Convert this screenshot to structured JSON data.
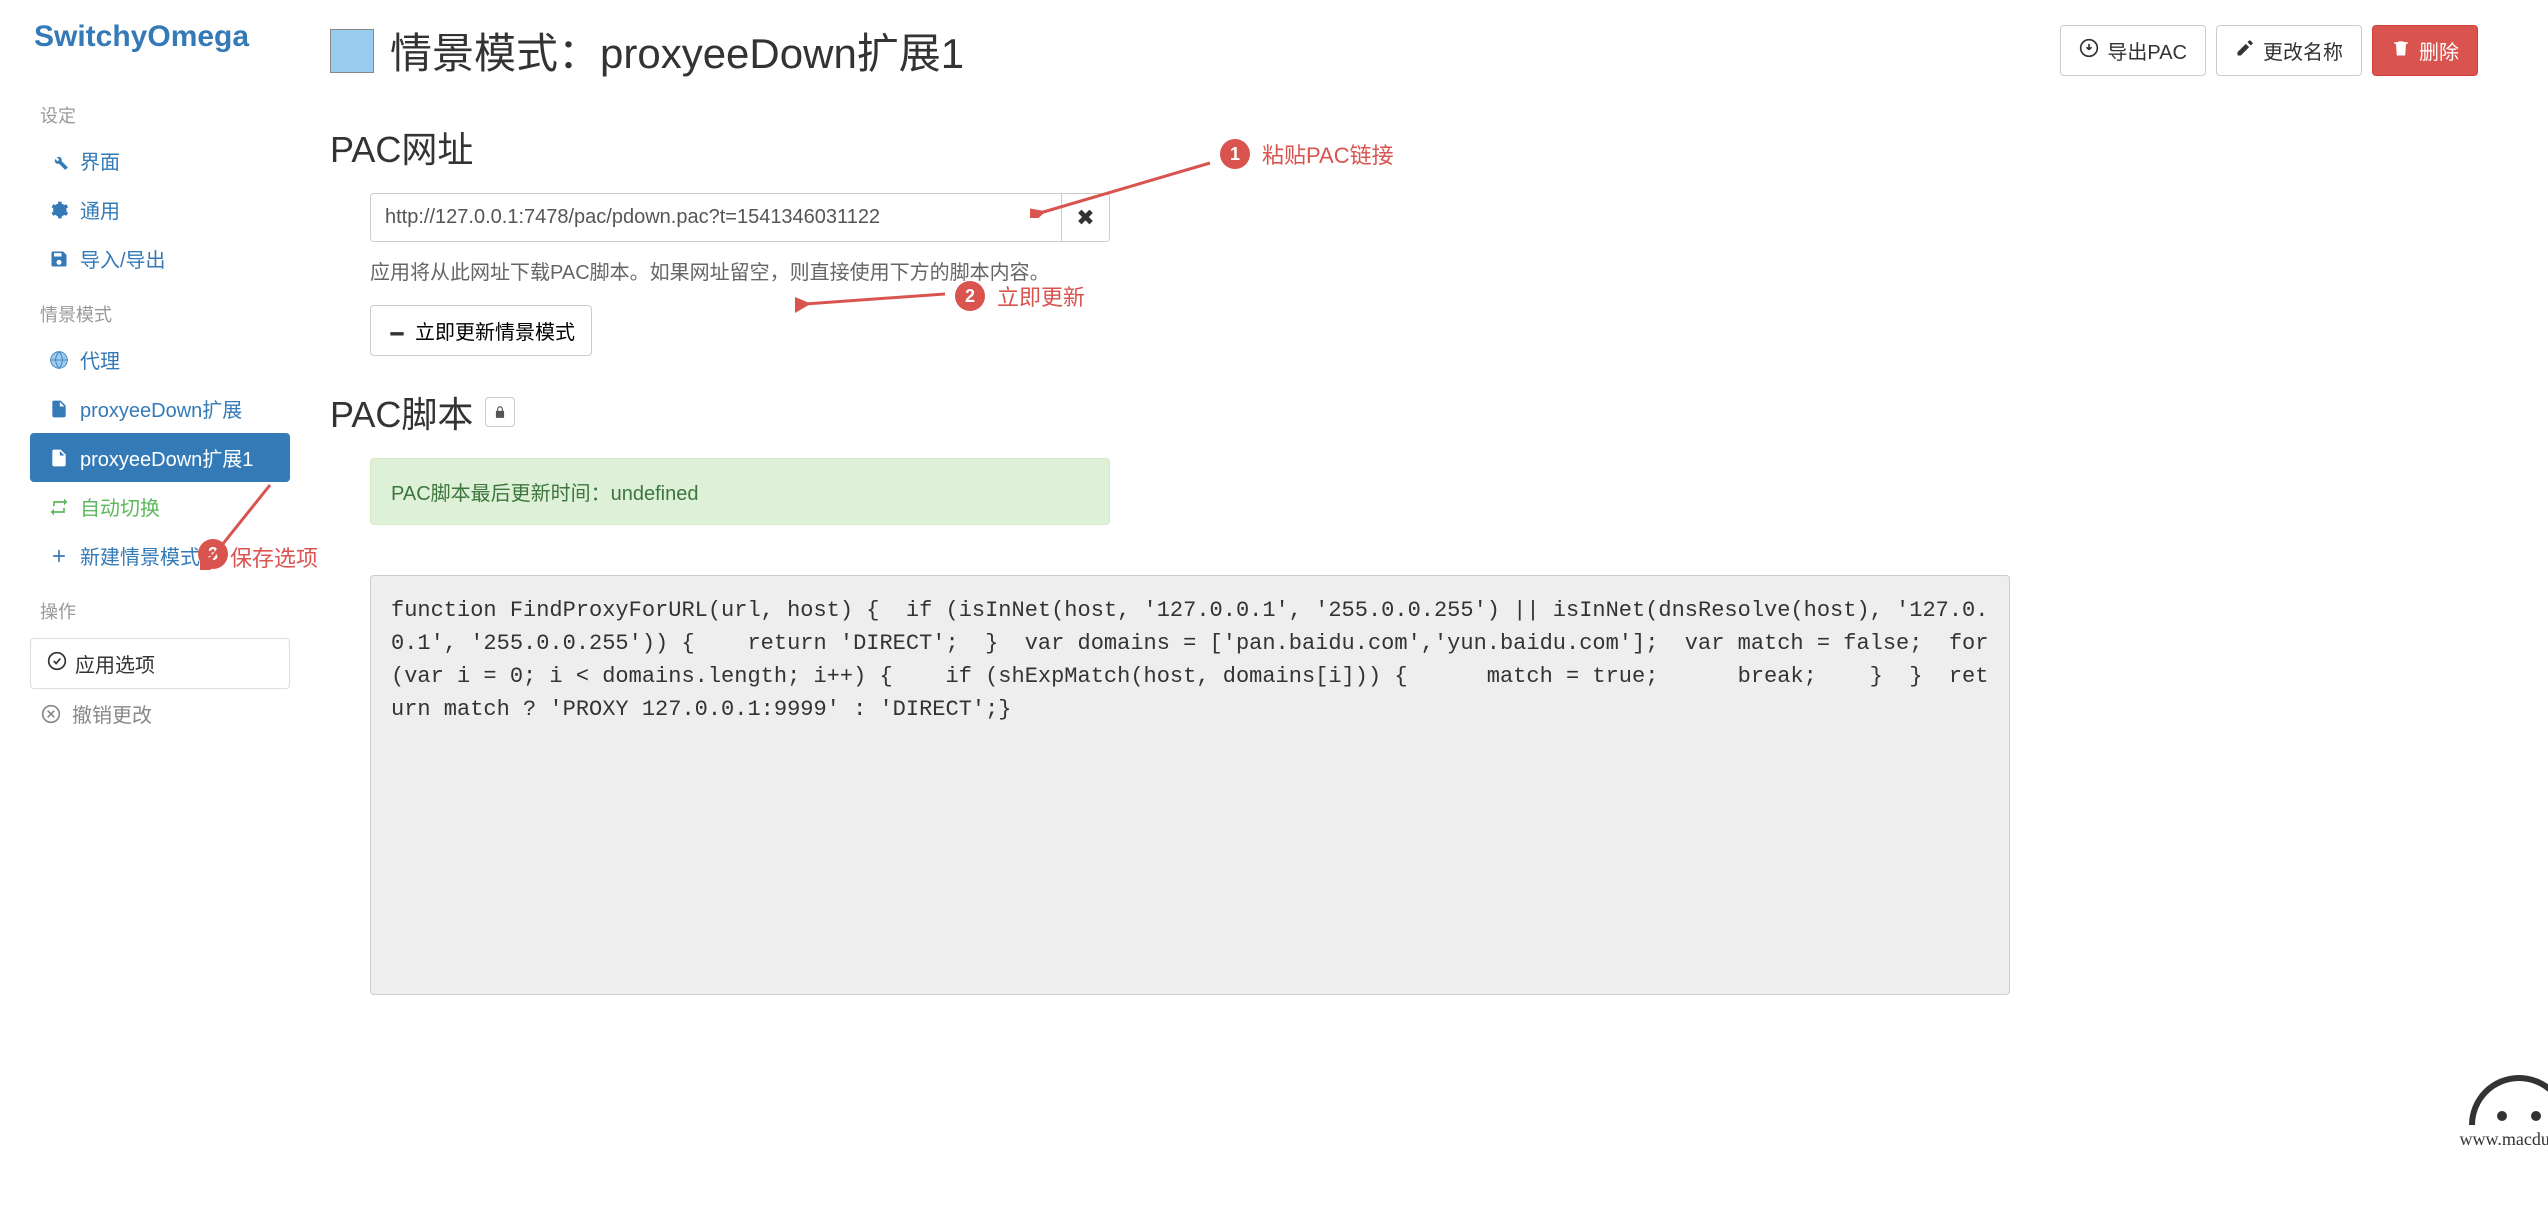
{
  "brand": "SwitchyOmega",
  "sidebar": {
    "section_settings": "设定",
    "items_settings": [
      {
        "label": "界面",
        "icon": "wrench"
      },
      {
        "label": "通用",
        "icon": "gear"
      },
      {
        "label": "导入/导出",
        "icon": "save"
      }
    ],
    "section_profiles": "情景模式",
    "items_profiles": [
      {
        "label": "代理",
        "icon": "globe",
        "style": ""
      },
      {
        "label": "proxyeeDown扩展",
        "icon": "file",
        "style": ""
      },
      {
        "label": "proxyeeDown扩展1",
        "icon": "file",
        "style": "active"
      },
      {
        "label": "自动切换",
        "icon": "swap",
        "style": "green"
      },
      {
        "label": "新建情景模式…",
        "icon": "plus",
        "style": ""
      }
    ],
    "section_actions": "操作",
    "apply_label": "应用选项",
    "revert_label": "撤销更改"
  },
  "header": {
    "title": "情景模式：proxyeeDown扩展1",
    "export_pac": "导出PAC",
    "rename": "更改名称",
    "delete": "删除"
  },
  "pac_url": {
    "title": "PAC网址",
    "value": "http://127.0.0.1:7478/pac/pdown.pac?t=1541346031122",
    "help": "应用将从此网址下载PAC脚本。如果网址留空，则直接使用下方的脚本内容。",
    "update_btn": "立即更新情景模式"
  },
  "pac_script": {
    "title": "PAC脚本",
    "last_update": "PAC脚本最后更新时间：undefined",
    "code": "function FindProxyForURL(url, host) {  if (isInNet(host, '127.0.0.1', '255.0.0.255') || isInNet(dnsResolve(host), '127.0.0.1', '255.0.0.255')) {    return 'DIRECT';  }  var domains = ['pan.baidu.com','yun.baidu.com'];  var match = false;  for (var i = 0; i < domains.length; i++) {    if (shExpMatch(host, domains[i])) {      match = true;      break;    }  }  return match ? 'PROXY 127.0.0.1:9999' : 'DIRECT';}"
  },
  "annotations": {
    "a1": "粘贴PAC链接",
    "a2": "立即更新",
    "a3": "保存选项"
  },
  "watermark": "www.macdu.org"
}
